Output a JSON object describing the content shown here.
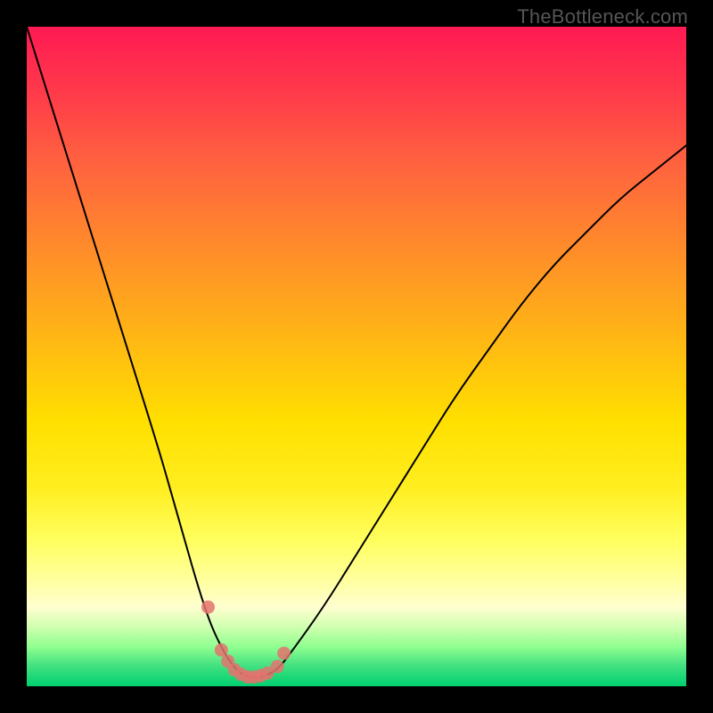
{
  "watermark": "TheBottleneck.com",
  "chart_data": {
    "type": "line",
    "title": "",
    "xlabel": "",
    "ylabel": "",
    "xlim": [
      0,
      100
    ],
    "ylim": [
      0,
      100
    ],
    "x": [
      0,
      5,
      10,
      15,
      20,
      22,
      24,
      26,
      28,
      30,
      31,
      32,
      33,
      34,
      35,
      36,
      38,
      40,
      45,
      50,
      55,
      60,
      65,
      70,
      75,
      80,
      85,
      90,
      95,
      100
    ],
    "series": [
      {
        "name": "bottleneck-curve",
        "values": [
          100,
          84,
          68,
          52,
          36,
          29,
          22,
          15,
          9,
          5,
          3.5,
          2.3,
          1.6,
          1.3,
          1.3,
          1.5,
          2.5,
          5,
          12,
          20,
          28,
          36,
          44,
          51,
          58,
          64,
          69,
          74,
          78,
          82
        ]
      }
    ],
    "markers": {
      "x": [
        27.5,
        29.5,
        30.5,
        31.5,
        32.5,
        33.5,
        34.5,
        35.5,
        36.5,
        38,
        39
      ],
      "y": [
        12,
        5.5,
        3.8,
        2.5,
        1.8,
        1.4,
        1.4,
        1.6,
        2,
        3,
        5
      ]
    }
  }
}
